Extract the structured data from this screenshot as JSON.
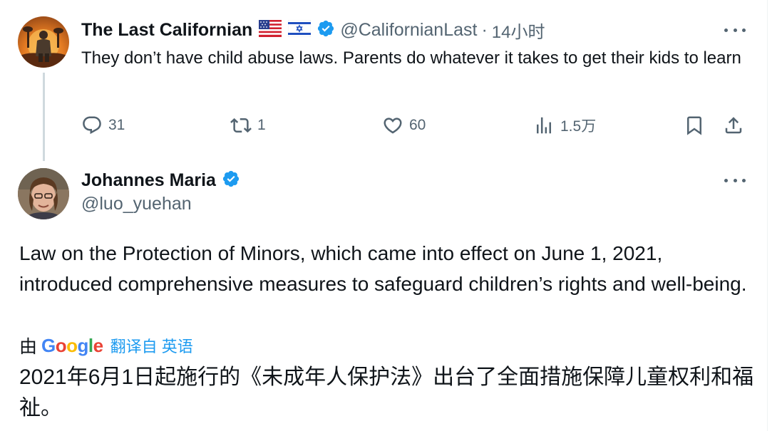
{
  "tweet1": {
    "display_name": "The Last Californian",
    "flags": [
      "us-flag-icon",
      "israel-flag-icon"
    ],
    "verified": true,
    "handle": "@CalifornianLast",
    "separator": "·",
    "time": "14小时",
    "text": "They don’t have child abuse laws.  Parents do whatever it takes to get their kids to learn",
    "actions": {
      "reply_count": "31",
      "retweet_count": "1",
      "like_count": "60",
      "view_count": "1.5万"
    }
  },
  "tweet2": {
    "display_name": "Johannes Maria",
    "verified": true,
    "handle": "@luo_yuehan",
    "text": "Law on the Protection of Minors, which came into effect on June 1, 2021, introduced comprehensive measures to safeguard children’s rights and well-being.",
    "translation": {
      "by_label": "由",
      "provider": "Google",
      "translated_from_label": "翻译自 英语",
      "text": "2021年6月1日起施行的《未成年人保护法》出台了全面措施保障儿童权利和福祉。"
    }
  },
  "colors": {
    "text_primary": "#0f1419",
    "text_secondary": "#536471",
    "accent_blue": "#1d9bf0",
    "thread_line": "#cfd9de"
  }
}
